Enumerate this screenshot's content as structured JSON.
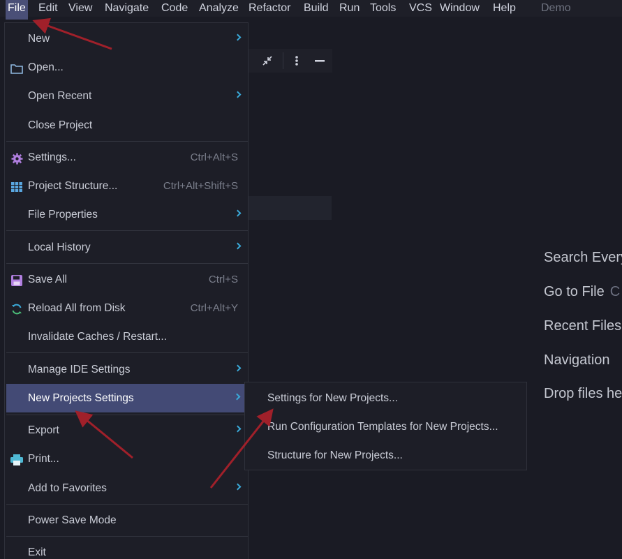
{
  "menubar": {
    "items": [
      "File",
      "Edit",
      "View",
      "Navigate",
      "Code",
      "Analyze",
      "Refactor",
      "Build",
      "Run",
      "Tools",
      "VCS",
      "Window",
      "Help"
    ],
    "project": "Demo"
  },
  "file_menu": {
    "items": [
      {
        "label": "New",
        "shortcut": "",
        "icon": "",
        "submenu": true
      },
      {
        "label": "Open...",
        "shortcut": "",
        "icon": "folder-icon",
        "submenu": false
      },
      {
        "label": "Open Recent",
        "shortcut": "",
        "icon": "",
        "submenu": true
      },
      {
        "label": "Close Project",
        "shortcut": "",
        "icon": "",
        "submenu": false
      },
      {
        "label": "Settings...",
        "shortcut": "Ctrl+Alt+S",
        "icon": "gear-icon",
        "submenu": false
      },
      {
        "label": "Project Structure...",
        "shortcut": "Ctrl+Alt+Shift+S",
        "icon": "grid-icon",
        "submenu": false
      },
      {
        "label": "File Properties",
        "shortcut": "",
        "icon": "",
        "submenu": true
      },
      {
        "label": "Local History",
        "shortcut": "",
        "icon": "",
        "submenu": true
      },
      {
        "label": "Save All",
        "shortcut": "Ctrl+S",
        "icon": "save-icon",
        "submenu": false
      },
      {
        "label": "Reload All from Disk",
        "shortcut": "Ctrl+Alt+Y",
        "icon": "reload-icon",
        "submenu": false
      },
      {
        "label": "Invalidate Caches / Restart...",
        "shortcut": "",
        "icon": "",
        "submenu": false
      },
      {
        "label": "Manage IDE Settings",
        "shortcut": "",
        "icon": "",
        "submenu": true
      },
      {
        "label": "New Projects Settings",
        "shortcut": "",
        "icon": "",
        "submenu": true
      },
      {
        "label": "Export",
        "shortcut": "",
        "icon": "",
        "submenu": true
      },
      {
        "label": "Print...",
        "shortcut": "",
        "icon": "printer-icon",
        "submenu": false
      },
      {
        "label": "Add to Favorites",
        "shortcut": "",
        "icon": "",
        "submenu": true
      },
      {
        "label": "Power Save Mode",
        "shortcut": "",
        "icon": "",
        "submenu": false
      },
      {
        "label": "Exit",
        "shortcut": "",
        "icon": "",
        "submenu": false
      }
    ]
  },
  "submenu": {
    "items": [
      "Settings for New Projects...",
      "Run Configuration Templates for New Projects...",
      "Structure for New Projects..."
    ]
  },
  "welcome": {
    "hints": [
      {
        "label": "Search Every",
        "shortcut": ""
      },
      {
        "label": "Go to File",
        "shortcut": "C"
      },
      {
        "label": "Recent Files",
        "shortcut": ""
      },
      {
        "label": "Navigation",
        "shortcut": ""
      },
      {
        "label": "Drop files he",
        "shortcut": ""
      }
    ]
  },
  "colors": {
    "accent": "#434a75",
    "chevron": "#3aa9d8",
    "arrow": "#a0202a",
    "icon_purple": "#b17fe0",
    "icon_blue": "#5aa7e0"
  }
}
